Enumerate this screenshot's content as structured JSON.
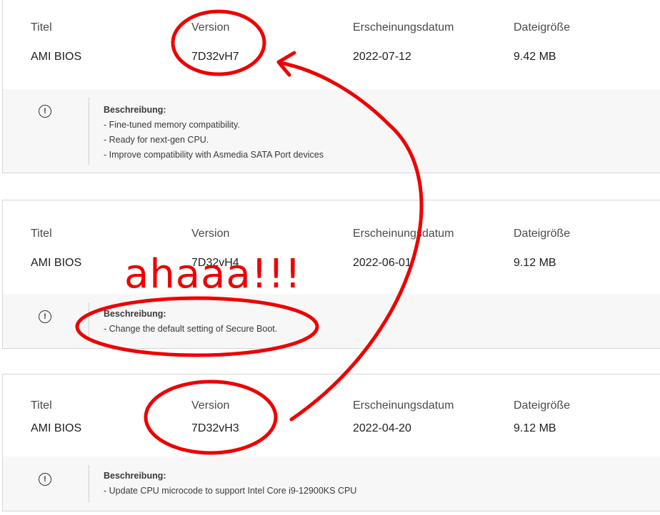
{
  "labels": {
    "title": "Titel",
    "version": "Version",
    "release_date": "Erscheinungsdatum",
    "file_size": "Dateigröße",
    "description": "Beschreibung:"
  },
  "entries": [
    {
      "title": "AMI BIOS",
      "version": "7D32vH7",
      "release_date": "2022-07-12",
      "file_size": "9.42 MB",
      "description_lines": [
        "- Fine-tuned memory compatibility.",
        "- Ready for next-gen CPU.",
        "- Improve compatibility with Asmedia SATA Port devices"
      ]
    },
    {
      "title": "AMI BIOS",
      "version": "7D32vH4",
      "release_date": "2022-06-01",
      "file_size": "9.12 MB",
      "description_lines": [
        "- Change the default setting of Secure Boot."
      ]
    },
    {
      "title": "AMI BIOS",
      "version": "7D32vH3",
      "release_date": "2022-04-20",
      "file_size": "9.12 MB",
      "description_lines": [
        "- Update CPU microcode to support Intel Core i9-12900KS CPU"
      ]
    }
  ],
  "annotation": {
    "text": "ahaaa!!!",
    "color": "#ee0000"
  },
  "info_icon_glyph": "!"
}
